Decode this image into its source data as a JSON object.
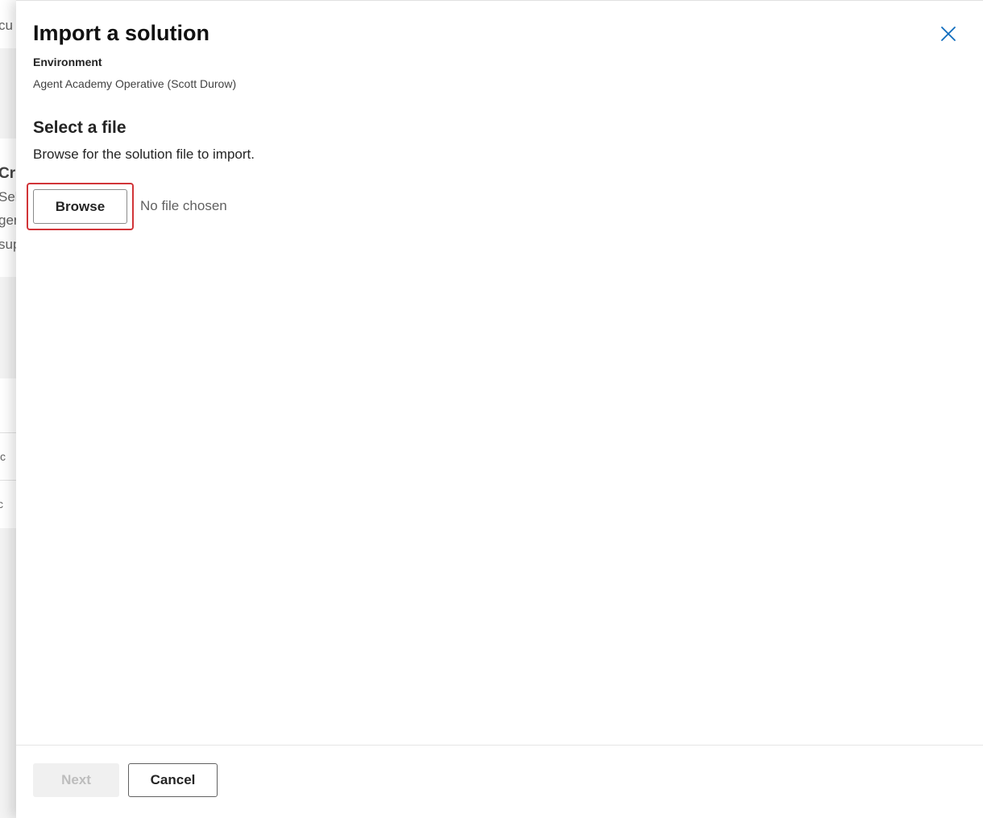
{
  "background": {
    "fragments": [
      "cu",
      "Cr",
      "Sel",
      "ger",
      "sup",
      "c",
      "c"
    ]
  },
  "panel": {
    "title": "Import a solution",
    "environment_label": "Environment",
    "environment_value": "Agent Academy Operative (Scott Durow)",
    "section_title": "Select a file",
    "section_description": "Browse for the solution file to import.",
    "browse_label": "Browse",
    "file_status": "No file chosen",
    "next_label": "Next",
    "cancel_label": "Cancel",
    "close_icon": "close-icon"
  },
  "colors": {
    "accent": "#0f6cbd",
    "highlight": "#d13438",
    "disabled_text": "#bdbdbd"
  }
}
